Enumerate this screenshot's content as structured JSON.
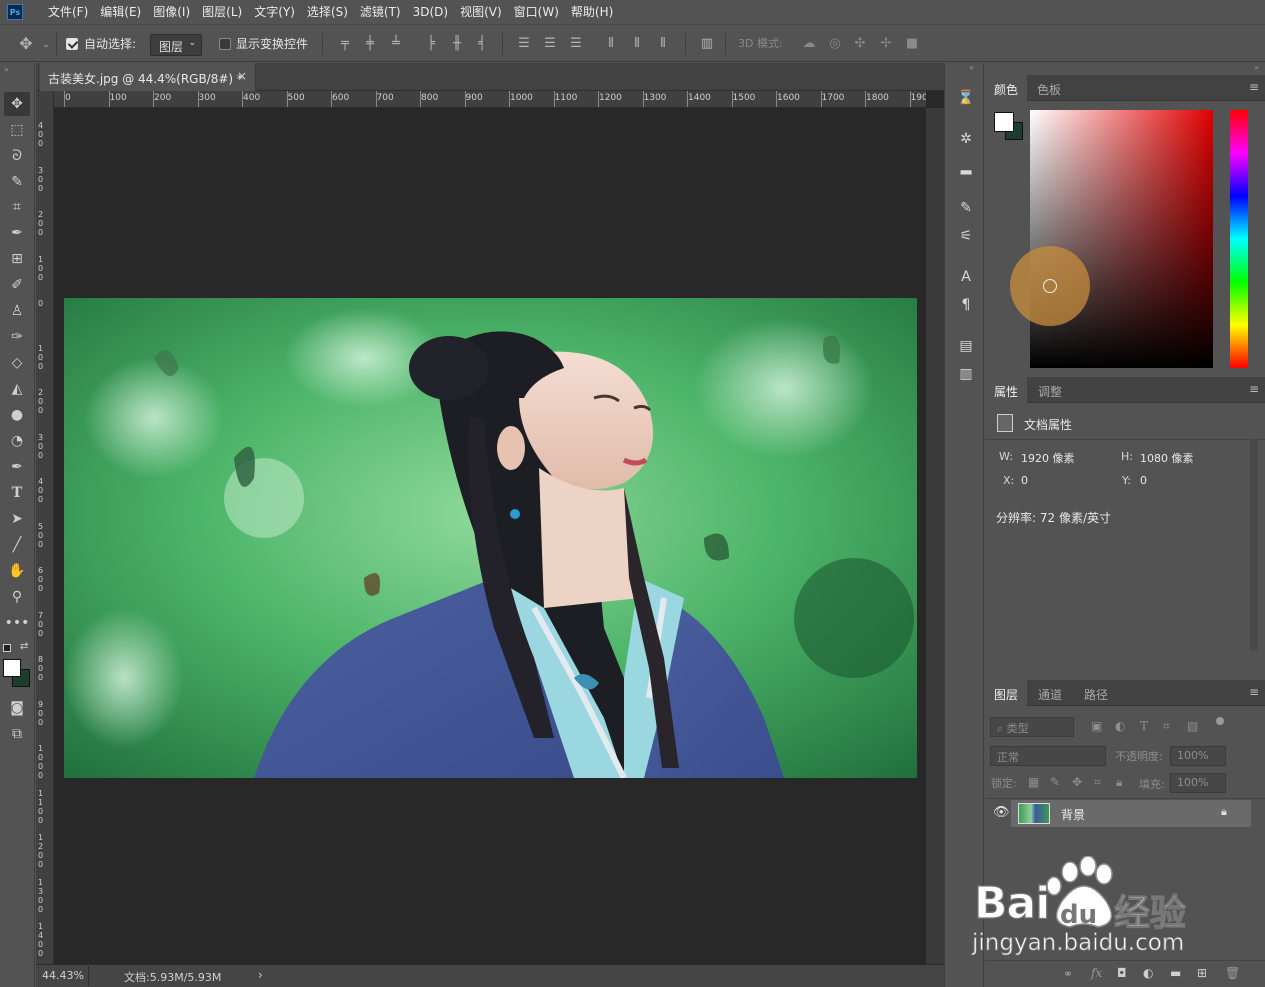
{
  "app": {
    "logo": "Ps"
  },
  "menu": [
    "文件(F)",
    "编辑(E)",
    "图像(I)",
    "图层(L)",
    "文字(Y)",
    "选择(S)",
    "滤镜(T)",
    "3D(D)",
    "视图(V)",
    "窗口(W)",
    "帮助(H)"
  ],
  "options": {
    "auto_select_label": "自动选择:",
    "auto_select_checked": true,
    "auto_select_target": "图层",
    "show_transform_label": "显示变换控件",
    "show_transform_checked": false,
    "mode_3d_label": "3D 模式:"
  },
  "document": {
    "tab_title": "古装美女.jpg @ 44.4%(RGB/8#) *",
    "close_glyph": "×",
    "ruler_h": [
      "0",
      "100",
      "200",
      "300",
      "400",
      "500",
      "600",
      "700",
      "800",
      "900",
      "1000",
      "1100",
      "1200",
      "1300",
      "1400",
      "1500",
      "1600",
      "1700",
      "1800",
      "190"
    ],
    "ruler_v": [
      "4 0 0",
      "3 0 0",
      "2 0 0",
      "1 0 0",
      "0",
      "1 0 0",
      "2 0 0",
      "3 0 0",
      "4 0 0",
      "5 0 0",
      "6 0 0",
      "7 0 0",
      "8 0 0",
      "9 0 0",
      "1 0 0 0",
      "1 1 0 0",
      "1 2 0 0",
      "1 3 0 0",
      "1 4 0 0"
    ],
    "zoom": "44.43%",
    "doc_size": "文档:5.93M/5.93M",
    "status_arrow": "›"
  },
  "colors": {
    "foreground": "#ffffff",
    "background": "#1e3c30",
    "picker_hue": "#e00000"
  },
  "color_panel": {
    "tabs": [
      "颜色",
      "色板"
    ],
    "active": "颜色"
  },
  "properties_panel": {
    "tabs": [
      "属性",
      "调整"
    ],
    "active": "属性",
    "section": "文档属性",
    "w_label": "W:",
    "w_value": "1920 像素",
    "h_label": "H:",
    "h_value": "1080 像素",
    "x_label": "X:",
    "x_value": "0",
    "y_label": "Y:",
    "y_value": "0",
    "resolution": "分辨率: 72 像素/英寸"
  },
  "layers_panel": {
    "tabs": [
      "图层",
      "通道",
      "路径"
    ],
    "active": "图层",
    "filter_label": "类型",
    "blend_mode": "正常",
    "opacity_label": "不透明度:",
    "opacity_value": "100%",
    "lock_label": "锁定:",
    "fill_label": "填充:",
    "fill_value": "100%",
    "layers": [
      {
        "name": "背景",
        "visible": true,
        "locked": true
      }
    ],
    "footer_fx": "fx"
  },
  "watermark": {
    "brand": "Bai",
    "brand2": "du",
    "suffix": "经验",
    "url": "jingyan.baidu.com"
  }
}
